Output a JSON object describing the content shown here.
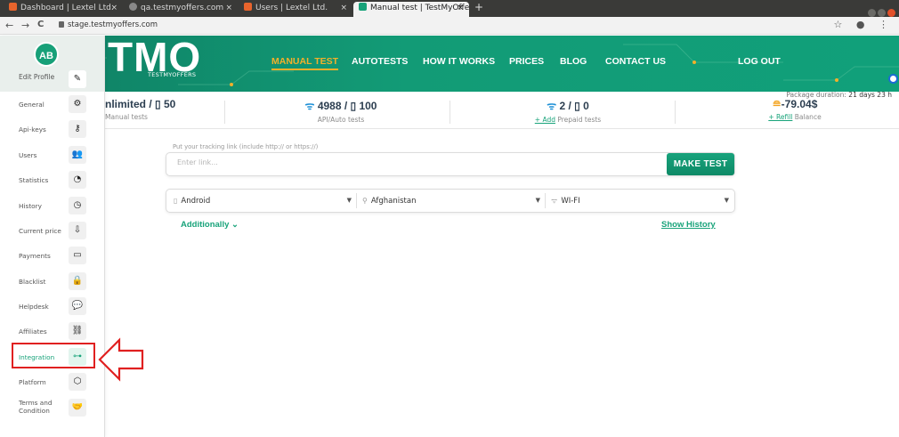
{
  "browser": {
    "tabs": [
      {
        "title": "Dashboard | Lextel Ltd.",
        "favicon_color": "#e8642c"
      },
      {
        "title": "qa.testmyoffers.com",
        "favicon_color": "#888888"
      },
      {
        "title": "Users | Lextel Ltd.",
        "favicon_color": "#e8642c"
      },
      {
        "title": "Manual test | TestMyOffe",
        "favicon_color": "#18a37a"
      }
    ],
    "tab_close": "×",
    "new_tab": "+",
    "url": "stage.testmyoffers.com",
    "nav_back": "←",
    "nav_forward": "→",
    "nav_reload": "C",
    "right_icons": "☆ ● ⋮"
  },
  "header": {
    "logo": "TMO",
    "logo_sub": "TESTMYOFFERS",
    "nav": [
      "MANUAL TEST",
      "AUTOTESTS",
      "HOW IT WORKS",
      "PRICES",
      "BLOG",
      "CONTACT US"
    ],
    "logout": "LOG OUT"
  },
  "stats": {
    "manual": {
      "value": "nlimited / ▯ 50",
      "label": "Manual tests"
    },
    "api": {
      "value": "4988 / ▯ 100",
      "label": "API/Auto tests"
    },
    "prepaid": {
      "value": "2 / ▯ 0",
      "add": "+ Add",
      "label": "Prepaid tests"
    },
    "balance": {
      "value": "-79.04$",
      "refill": "+ Refill",
      "label": "Balance"
    },
    "package_label": "Package duration:",
    "package_value": "21 days 23 h"
  },
  "form": {
    "tracking_label": "Put your tracking link (include http:// or https://)",
    "link_placeholder": "Enter link...",
    "make_test": "MAKE TEST",
    "device": "Android",
    "country": "Afghanistan",
    "network": "WI-FI",
    "additionally": "Additionally",
    "show_history": "Show History"
  },
  "sidebar": {
    "avatar": "AB",
    "edit_profile": "Edit Profile",
    "items": [
      {
        "label": "General",
        "icon": "⚙"
      },
      {
        "label": "Api-keys",
        "icon": "⚷"
      },
      {
        "label": "Users",
        "icon": "👥"
      },
      {
        "label": "Statistics",
        "icon": "◔"
      },
      {
        "label": "History",
        "icon": "◷"
      },
      {
        "label": "Current price",
        "icon": "⇩"
      },
      {
        "label": "Payments",
        "icon": "▭"
      },
      {
        "label": "Blacklist",
        "icon": "🔒"
      },
      {
        "label": "Helpdesk",
        "icon": "💬"
      },
      {
        "label": "Affiliates",
        "icon": "⛓"
      },
      {
        "label": "Integration",
        "icon": "⊶"
      },
      {
        "label": "Platform",
        "icon": "⬡"
      },
      {
        "label": "Terms and Condition",
        "icon": "🤝"
      }
    ],
    "active_item": "Integration"
  },
  "colors": {
    "brand_green": "#18a37a",
    "active_nav": "#f3b02a",
    "annotation_red": "#e02020"
  }
}
